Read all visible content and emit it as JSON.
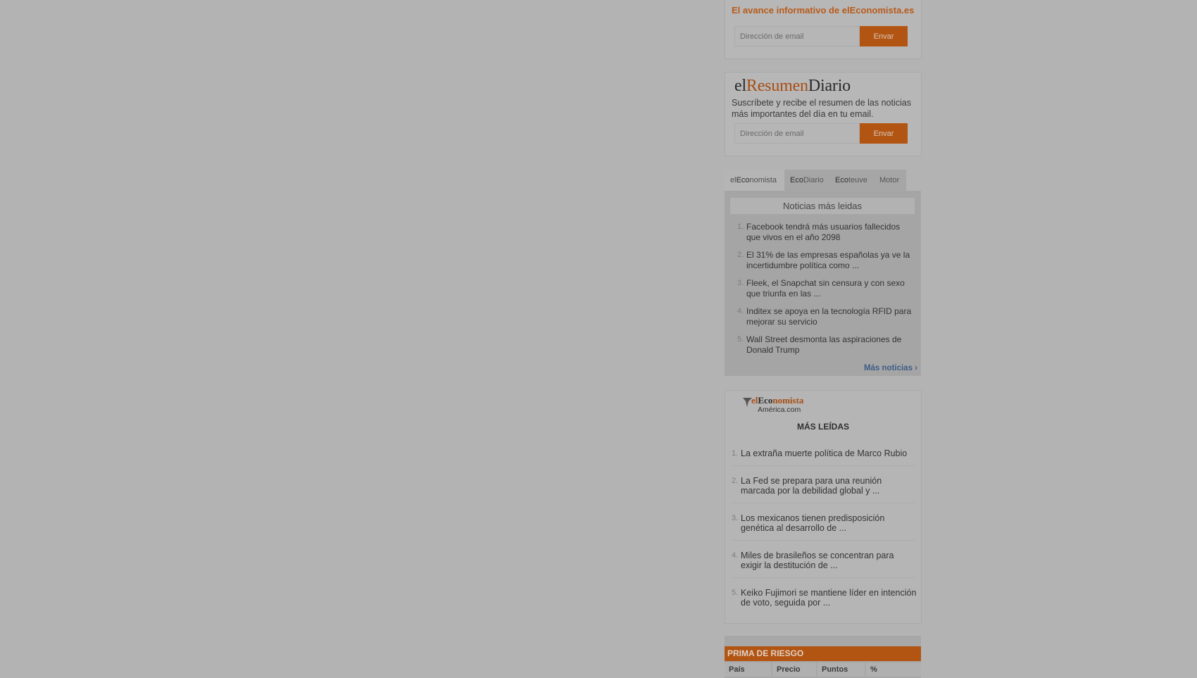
{
  "avance": {
    "tagline": "El avance informativo de elEconomista.es",
    "email_placeholder": "Dirección de email",
    "send_label": "Envar"
  },
  "resumen": {
    "brand_el": "el",
    "brand_resumen": "Resumen",
    "brand_diario": "Diario",
    "description": "Suscríbete y recibe el resumen de las noticias más importantes del día en tu email.",
    "email_placeholder": "Dirección de email",
    "send_label": "Envar"
  },
  "tabs": [
    {
      "prefix": "el",
      "bold": "Eco",
      "rest": "nomista",
      "active": true
    },
    {
      "prefix": "",
      "bold": "Eco",
      "rest": "Diario",
      "active": false
    },
    {
      "prefix": "",
      "bold": "Eco",
      "rest": "teuve",
      "active": false
    },
    {
      "prefix": "",
      "bold": "",
      "rest": "Motor",
      "active": false
    }
  ],
  "most_read": {
    "header": "Noticias más leidas",
    "items": [
      {
        "num": "1.",
        "text": "Facebook tendrá más usuarios fallecidos que vivos en el año 2098"
      },
      {
        "num": "2.",
        "text": "El 31% de las empresas españolas ya ve la incertidumbre política como ..."
      },
      {
        "num": "3.",
        "text": "Fleek, el Snapchat sin censura y con sexo que triunfa en las ..."
      },
      {
        "num": "4.",
        "text": "Inditex se apoya en la tecnología RFID para mejorar su servicio"
      },
      {
        "num": "5.",
        "text": "Wall Street desmonta las aspiraciones de Donald Trump"
      }
    ],
    "more_label": "Más noticias ›"
  },
  "america": {
    "logo_el": "el",
    "logo_eco": "Eco",
    "logo_nomista": "nomista",
    "logo_sub": "América.com",
    "title": "MÁS LEÍDAS",
    "items": [
      {
        "num": "1.",
        "text": "La extraña muerte política de Marco Rubio"
      },
      {
        "num": "2.",
        "text": "La Fed se prepara para una reunión marcada por la debilidad global y ..."
      },
      {
        "num": "3.",
        "text": "Los mexicanos tienen predisposición genética al desarrollo de ..."
      },
      {
        "num": "4.",
        "text": "Miles de brasileños se concentran para exigir la destitución de ..."
      },
      {
        "num": "5.",
        "text": "Keiko Fujimori se mantiene líder en intención de voto, seguida por ..."
      }
    ]
  },
  "risk": {
    "title": "PRIMA DE RIESGO",
    "columns": [
      "País",
      "Precio",
      "Puntos",
      "%"
    ]
  }
}
